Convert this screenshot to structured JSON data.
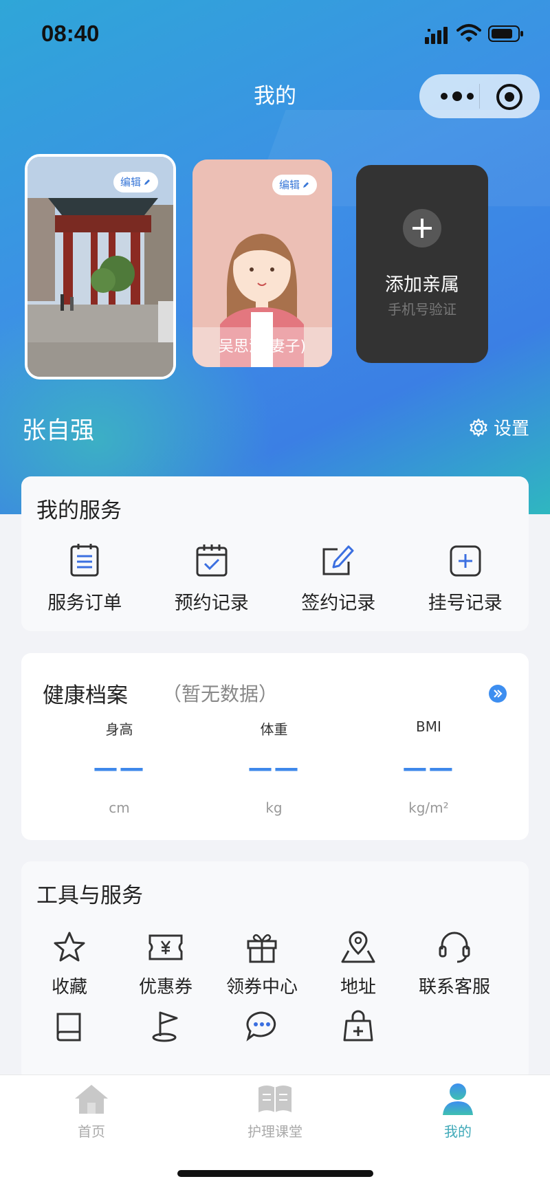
{
  "status_bar": {
    "time": "08:40"
  },
  "nav": {
    "title": "我的"
  },
  "family_cards": {
    "self": {
      "edit_label": "编辑"
    },
    "wife": {
      "edit_label": "编辑",
      "caption": "吴思洁(妻子)"
    },
    "add": {
      "title": "添加亲属",
      "subtitle": "手机号验证"
    }
  },
  "profile": {
    "name": "张自强",
    "settings_label": "设置"
  },
  "services": {
    "title": "我的服务",
    "items": [
      {
        "label": "服务订单",
        "icon": "order-list-icon"
      },
      {
        "label": "预约记录",
        "icon": "calendar-check-icon"
      },
      {
        "label": "签约记录",
        "icon": "edit-sign-icon"
      },
      {
        "label": "挂号记录",
        "icon": "plus-square-icon"
      }
    ]
  },
  "health": {
    "title": "健康档案",
    "subtitle": "（暂无数据）",
    "metrics": [
      {
        "name": "身高",
        "value": "——",
        "unit": "cm"
      },
      {
        "name": "体重",
        "value": "——",
        "unit": "kg"
      },
      {
        "name": "BMI",
        "value": "——",
        "unit": "kg/m²"
      }
    ]
  },
  "tools": {
    "title": "工具与服务",
    "items": [
      {
        "label": "收藏",
        "icon": "star-icon"
      },
      {
        "label": "优惠券",
        "icon": "coupon-icon"
      },
      {
        "label": "领券中心",
        "icon": "gift-icon"
      },
      {
        "label": "地址",
        "icon": "map-pin-icon"
      },
      {
        "label": "联系客服",
        "icon": "headset-icon"
      },
      {
        "label": "",
        "icon": "book-icon"
      },
      {
        "label": "",
        "icon": "flag-icon"
      },
      {
        "label": "",
        "icon": "chat-icon"
      },
      {
        "label": "",
        "icon": "medical-bag-icon"
      }
    ]
  },
  "tabbar": {
    "items": [
      {
        "label": "首页",
        "icon": "home-icon",
        "active": false
      },
      {
        "label": "护理课堂",
        "icon": "open-book-icon",
        "active": false
      },
      {
        "label": "我的",
        "icon": "user-icon",
        "active": true
      }
    ]
  },
  "colors": {
    "accent": "#3d8ef0",
    "active_tab": "#3fa9b8",
    "metric_dash": "#3e88ea"
  }
}
